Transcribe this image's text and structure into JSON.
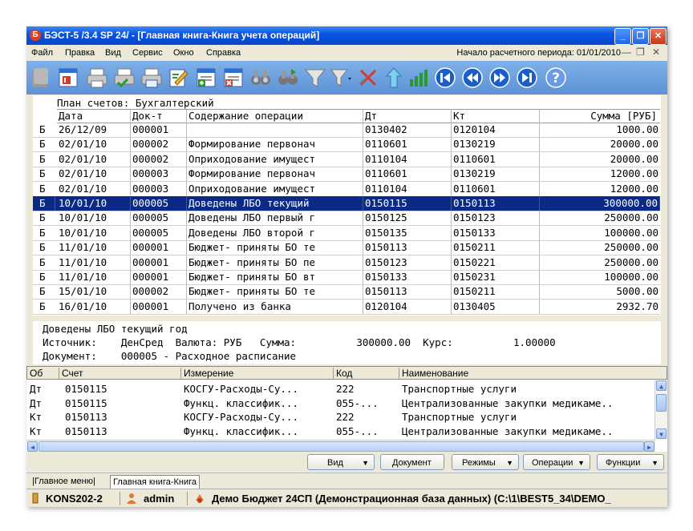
{
  "title": "БЭСТ-5 /3.4 SP 24/ - [Главная книга-Книга учета операций]",
  "menu": [
    "Файл",
    "Правка",
    "Вид",
    "Сервис",
    "Окно",
    "Справка"
  ],
  "period": "Начало расчетного периода: 01/01/2010",
  "plan": "План счетов: Бухгалтерский",
  "headers": {
    "date": "Дата",
    "doc": "Док-т",
    "content": "Содержание операции",
    "dt": "Дт",
    "kt": "Кт",
    "sum": "Сумма [РУБ]"
  },
  "rows": [
    {
      "b": "Б",
      "date": "26/12/09",
      "doc": "000001",
      "content": "",
      "dt": "0130402",
      "kt": "0120104",
      "sum": "1000.00"
    },
    {
      "b": "Б",
      "date": "02/01/10",
      "doc": "000002",
      "content": "Формирование первонач",
      "dt": "0110601",
      "kt": "0130219",
      "sum": "20000.00"
    },
    {
      "b": "Б",
      "date": "02/01/10",
      "doc": "000002",
      "content": "Оприходование имущест",
      "dt": "0110104",
      "kt": "0110601",
      "sum": "20000.00"
    },
    {
      "b": "Б",
      "date": "02/01/10",
      "doc": "000003",
      "content": "Формирование первонач",
      "dt": "0110601",
      "kt": "0130219",
      "sum": "12000.00"
    },
    {
      "b": "Б",
      "date": "02/01/10",
      "doc": "000003",
      "content": "Оприходование имущест",
      "dt": "0110104",
      "kt": "0110601",
      "sum": "12000.00"
    },
    {
      "b": "Б",
      "date": "10/01/10",
      "doc": "000005",
      "content": "Доведены ЛБО текущий",
      "dt": "0150115",
      "kt": "0150113",
      "sum": "300000.00"
    },
    {
      "b": "Б",
      "date": "10/01/10",
      "doc": "000005",
      "content": "Доведены ЛБО первый г",
      "dt": "0150125",
      "kt": "0150123",
      "sum": "250000.00"
    },
    {
      "b": "Б",
      "date": "10/01/10",
      "doc": "000005",
      "content": "Доведены ЛБО второй г",
      "dt": "0150135",
      "kt": "0150133",
      "sum": "100000.00"
    },
    {
      "b": "Б",
      "date": "11/01/10",
      "doc": "000001",
      "content": "Бюджет- приняты БО те",
      "dt": "0150113",
      "kt": "0150211",
      "sum": "250000.00"
    },
    {
      "b": "Б",
      "date": "11/01/10",
      "doc": "000001",
      "content": "Бюджет- приняты БО пе",
      "dt": "0150123",
      "kt": "0150221",
      "sum": "250000.00"
    },
    {
      "b": "Б",
      "date": "11/01/10",
      "doc": "000001",
      "content": "Бюджет- приняты БО вт",
      "dt": "0150133",
      "kt": "0150231",
      "sum": "100000.00"
    },
    {
      "b": "Б",
      "date": "15/01/10",
      "doc": "000002",
      "content": "Бюджет- приняты БО те",
      "dt": "0150113",
      "kt": "0150211",
      "sum": "5000.00"
    },
    {
      "b": "Б",
      "date": "16/01/10",
      "doc": "000001",
      "content": "Получено из банка",
      "dt": "0120104",
      "kt": "0130405",
      "sum": "2932.70"
    }
  ],
  "selected_row": 5,
  "info": {
    "line1": "Доведены ЛБО текущий год",
    "line2": "Источник:    ДенСред  Валюта: РУБ   Сумма:          300000.00  Курс:          1.00000",
    "line3": "Документ:    000005 - Расходное расписание"
  },
  "sub_headers": {
    "ob": "Об",
    "account": "Счет",
    "measure": "Измерение",
    "code": "Код",
    "name": "Наименование"
  },
  "sub_rows": [
    {
      "ob": "Дт",
      "account": "0150115",
      "measure": "КОСГУ-Расходы-Су...",
      "code": "222",
      "name": "Транспортные услуги"
    },
    {
      "ob": "Дт",
      "account": "0150115",
      "measure": "Функц. классифик...",
      "code": "055-...",
      "name": "Централизованные закупки медикаме.."
    },
    {
      "ob": "Кт",
      "account": "0150113",
      "measure": "КОСГУ-Расходы-Су...",
      "code": "222",
      "name": "Транспортные услуги"
    },
    {
      "ob": "Кт",
      "account": "0150113",
      "measure": "Функц. классифик...",
      "code": "055-...",
      "name": "Централизованные закупки медикаме.."
    }
  ],
  "buttons": {
    "view": "Вид",
    "document": "Документ",
    "modes": "Режимы",
    "operations": "Операции",
    "functions": "Функции"
  },
  "tabs": [
    "Главное меню",
    "Главная книга-Книга"
  ],
  "status": {
    "station": "KONS202-2",
    "user": "admin",
    "db": "Демо Бюджет 24СП (Демонстрационная база данных) (C:\\1\\BEST5_34\\DEMO_"
  },
  "colors": {
    "selection": "#0b2a85",
    "title_bar": "#0a55e3",
    "toolbar": "#6b9edf"
  }
}
